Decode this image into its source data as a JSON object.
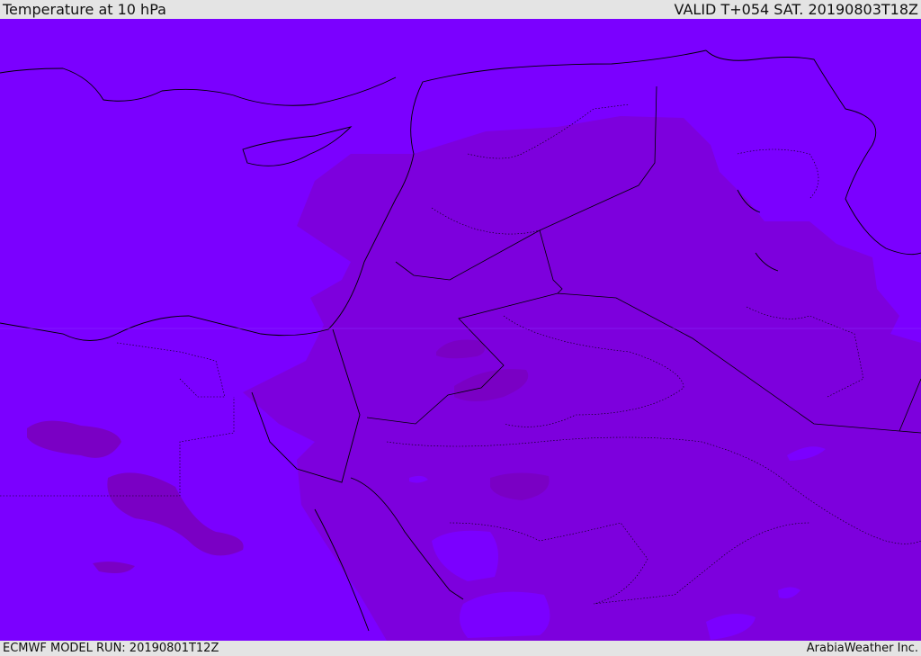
{
  "header": {
    "title": "Temperature at 10 hPa",
    "valid": "VALID T+054 SAT. 20190803T18Z"
  },
  "footer": {
    "model_run": "ECMWF MODEL RUN: 20190801T12Z",
    "credit": "ArabiaWeather Inc."
  },
  "colors": {
    "base_field": "#7b00ff",
    "warmer_field": "#7d00dd",
    "warmest_field": "#7a00c4",
    "cool_patch": "#7f1aff",
    "borders": "#000000"
  }
}
